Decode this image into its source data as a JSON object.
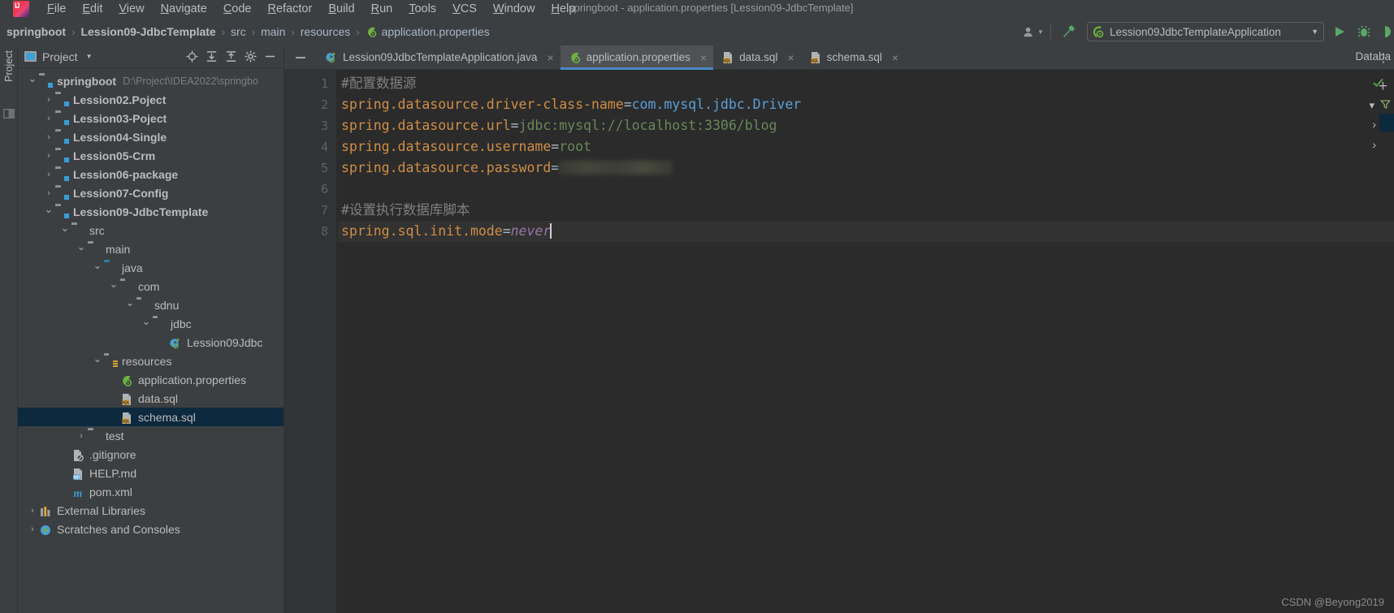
{
  "app": {
    "logo_icon": "intellij-idea-logo",
    "window_title": "springboot - application.properties [Lession09-JdbcTemplate]"
  },
  "menu": {
    "items": [
      {
        "label": "File",
        "mnemonic": "F"
      },
      {
        "label": "Edit",
        "mnemonic": "E"
      },
      {
        "label": "View",
        "mnemonic": "V"
      },
      {
        "label": "Navigate",
        "mnemonic": "N"
      },
      {
        "label": "Code",
        "mnemonic": "C"
      },
      {
        "label": "Refactor",
        "mnemonic": "R"
      },
      {
        "label": "Build",
        "mnemonic": "B"
      },
      {
        "label": "Run",
        "mnemonic": "R"
      },
      {
        "label": "Tools",
        "mnemonic": "T"
      },
      {
        "label": "VCS",
        "mnemonic": "V"
      },
      {
        "label": "Window",
        "mnemonic": "W"
      },
      {
        "label": "Help",
        "mnemonic": "H"
      }
    ]
  },
  "breadcrumb": {
    "separator": "›",
    "items": [
      {
        "label": "springboot",
        "style": "bold",
        "icon": ""
      },
      {
        "label": "Lession09-JdbcTemplate",
        "style": "bold",
        "icon": ""
      },
      {
        "label": "src",
        "style": "dim",
        "icon": ""
      },
      {
        "label": "main",
        "style": "dim",
        "icon": ""
      },
      {
        "label": "resources",
        "style": "dim",
        "icon": ""
      },
      {
        "label": "application.properties",
        "style": "dim",
        "icon": "spring-properties-icon"
      }
    ]
  },
  "navbar_right": {
    "account_icon": "user-avatar-icon",
    "account_caret": "▾",
    "build_icon": "hammer-icon",
    "run_config": {
      "icon": "spring-boot-run-icon",
      "label": "Lession09JdbcTemplateApplication",
      "caret": "▾"
    },
    "run_button_icon": "run-play-icon",
    "debug_button_icon": "debug-bug-icon",
    "more_icon": "run-with-coverage-icon"
  },
  "tool_strip": {
    "project_label": "Project"
  },
  "project_panel": {
    "title": "Project",
    "title_caret": "▾",
    "toolbar_icons": [
      "locate-target-icon",
      "expand-all-icon",
      "collapse-all-icon",
      "settings-gear-icon",
      "hide-minus-icon"
    ],
    "tree": [
      {
        "depth": 0,
        "twisty": "⌄",
        "icon": "module-folder-icon",
        "label": "springboot",
        "bold": true,
        "path": "D:\\Project\\IDEA2022\\springbo",
        "selected": false
      },
      {
        "depth": 1,
        "twisty": "›",
        "icon": "module-folder-icon",
        "label": "Lession02.Poject",
        "bold": true,
        "path": "",
        "selected": false
      },
      {
        "depth": 1,
        "twisty": "›",
        "icon": "module-folder-icon",
        "label": "Lession03-Poject",
        "bold": true,
        "path": "",
        "selected": false
      },
      {
        "depth": 1,
        "twisty": "›",
        "icon": "module-folder-icon",
        "label": "Lession04-Single",
        "bold": true,
        "path": "",
        "selected": false
      },
      {
        "depth": 1,
        "twisty": "›",
        "icon": "module-folder-icon",
        "label": "Lession05-Crm",
        "bold": true,
        "path": "",
        "selected": false
      },
      {
        "depth": 1,
        "twisty": "›",
        "icon": "module-folder-icon",
        "label": "Lession06-package",
        "bold": true,
        "path": "",
        "selected": false
      },
      {
        "depth": 1,
        "twisty": "›",
        "icon": "module-folder-icon",
        "label": "Lession07-Config",
        "bold": true,
        "path": "",
        "selected": false
      },
      {
        "depth": 1,
        "twisty": "⌄",
        "icon": "module-folder-icon",
        "label": "Lession09-JdbcTemplate",
        "bold": true,
        "path": "",
        "selected": false
      },
      {
        "depth": 2,
        "twisty": "⌄",
        "icon": "folder-icon",
        "label": "src",
        "bold": false,
        "path": "",
        "selected": false
      },
      {
        "depth": 3,
        "twisty": "⌄",
        "icon": "folder-icon",
        "label": "main",
        "bold": false,
        "path": "",
        "selected": false
      },
      {
        "depth": 4,
        "twisty": "⌄",
        "icon": "source-folder-icon",
        "label": "java",
        "bold": false,
        "path": "",
        "selected": false
      },
      {
        "depth": 5,
        "twisty": "⌄",
        "icon": "package-icon",
        "label": "com",
        "bold": false,
        "path": "",
        "selected": false
      },
      {
        "depth": 6,
        "twisty": "⌄",
        "icon": "package-icon",
        "label": "sdnu",
        "bold": false,
        "path": "",
        "selected": false
      },
      {
        "depth": 7,
        "twisty": "⌄",
        "icon": "package-icon",
        "label": "jdbc",
        "bold": false,
        "path": "",
        "selected": false
      },
      {
        "depth": 8,
        "twisty": "",
        "icon": "spring-boot-class-icon",
        "label": "Lession09Jdbc",
        "bold": false,
        "path": "",
        "selected": false
      },
      {
        "depth": 4,
        "twisty": "⌄",
        "icon": "resources-folder-icon",
        "label": "resources",
        "bold": false,
        "path": "",
        "selected": false
      },
      {
        "depth": 5,
        "twisty": "",
        "icon": "spring-properties-icon",
        "label": "application.properties",
        "bold": false,
        "path": "",
        "selected": false
      },
      {
        "depth": 5,
        "twisty": "",
        "icon": "sql-file-icon",
        "label": "data.sql",
        "bold": false,
        "path": "",
        "selected": false
      },
      {
        "depth": 5,
        "twisty": "",
        "icon": "sql-file-icon",
        "label": "schema.sql",
        "bold": false,
        "path": "",
        "selected": true
      },
      {
        "depth": 3,
        "twisty": "›",
        "icon": "folder-icon",
        "label": "test",
        "bold": false,
        "path": "",
        "selected": false
      },
      {
        "depth": 2,
        "twisty": "",
        "icon": "gitignore-file-icon",
        "label": ".gitignore",
        "bold": false,
        "path": "",
        "selected": false
      },
      {
        "depth": 2,
        "twisty": "",
        "icon": "markdown-file-icon",
        "label": "HELP.md",
        "bold": false,
        "path": "",
        "selected": false
      },
      {
        "depth": 2,
        "twisty": "",
        "icon": "maven-pom-icon",
        "label": "pom.xml",
        "bold": false,
        "path": "",
        "selected": false
      },
      {
        "depth": 0,
        "twisty": "›",
        "icon": "external-libraries-icon",
        "label": "External Libraries",
        "bold": false,
        "path": "",
        "selected": false
      },
      {
        "depth": 0,
        "twisty": "›",
        "icon": "scratches-icon",
        "label": "Scratches and Consoles",
        "bold": false,
        "path": "",
        "selected": false
      }
    ]
  },
  "editor_tabs": {
    "collapse_icon": "collapse-minus-icon",
    "more_icon": "tabs-more-icon",
    "close_glyph": "×",
    "tabs": [
      {
        "label": "Lession09JdbcTemplateApplication.java",
        "icon": "spring-boot-class-icon",
        "active": false
      },
      {
        "label": "application.properties",
        "icon": "spring-properties-icon",
        "active": true
      },
      {
        "label": "data.sql",
        "icon": "sql-file-icon",
        "active": false
      },
      {
        "label": "schema.sql",
        "icon": "sql-file-icon",
        "active": false
      }
    ]
  },
  "editor": {
    "inspection_status_icon": "inspection-ok-check",
    "line_numbers": [
      "1",
      "2",
      "3",
      "4",
      "5",
      "6",
      "7",
      "8"
    ],
    "lines": [
      {
        "no": "1",
        "type": "comment",
        "text": "#配置数据源"
      },
      {
        "no": "2",
        "type": "kv",
        "key": "spring.datasource.driver-class-name",
        "value": "com.mysql.jdbc.Driver",
        "value_style": "blue"
      },
      {
        "no": "3",
        "type": "kv",
        "key": "spring.datasource.url",
        "value": "jdbc:mysql://localhost:3306/blog",
        "value_style": "green"
      },
      {
        "no": "4",
        "type": "kv",
        "key": "spring.datasource.username",
        "value": "root",
        "value_style": "green"
      },
      {
        "no": "5",
        "type": "kv-blurred",
        "key": "spring.datasource.password",
        "value": "",
        "value_style": "blurred"
      },
      {
        "no": "6",
        "type": "blank",
        "text": ""
      },
      {
        "no": "7",
        "type": "comment",
        "text": "#设置执行数据库脚本"
      },
      {
        "no": "8",
        "type": "kv-caret",
        "key": "spring.sql.init.mode",
        "value": "never",
        "value_style": "italic-purple"
      }
    ]
  },
  "right_panel": {
    "database_label": "Databa",
    "add_icon": "+",
    "collapse_icon": "⌄",
    "filter_icon": "filter-icon",
    "expand_icons": [
      "›",
      "›"
    ]
  },
  "watermark": {
    "text": "CSDN @Beyong2019"
  },
  "colors": {
    "panel_bg": "#3c3f41",
    "editor_bg": "#2b2b2b",
    "gutter_bg": "#313335",
    "selection_bg": "#0d293e",
    "active_tab_bg": "#4e5254",
    "tab_underline": "#4a88c7",
    "key_orange": "#cf8e46",
    "string_green": "#6a8759",
    "value_blue": "#5c9fd6",
    "italic_purple": "#9876aa",
    "comment_grey": "#808080",
    "folder_blue": "#389fd6",
    "run_green": "#59a869"
  }
}
